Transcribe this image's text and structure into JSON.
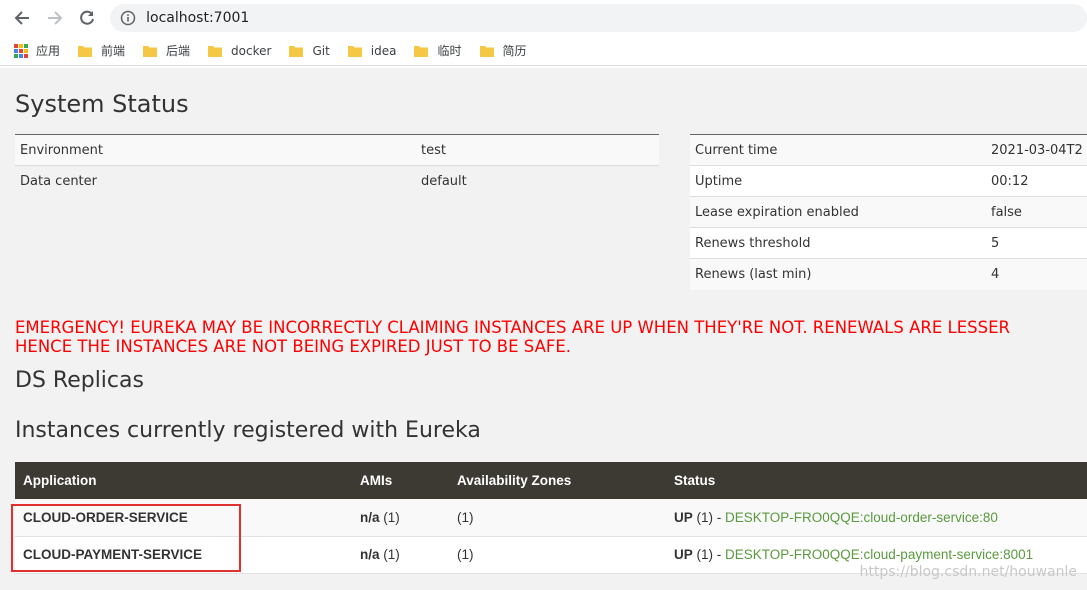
{
  "browser": {
    "url": "localhost:7001",
    "bookmarks": [
      "应用",
      "前端",
      "后端",
      "docker",
      "Git",
      "idea",
      "临时",
      "简历"
    ]
  },
  "page": {
    "title": "System Status",
    "env_rows": [
      {
        "k": "Environment",
        "v": "test"
      },
      {
        "k": "Data center",
        "v": "default"
      }
    ],
    "status_rows": [
      {
        "k": "Current time",
        "v": "2021-03-04T2"
      },
      {
        "k": "Uptime",
        "v": "00:12"
      },
      {
        "k": "Lease expiration enabled",
        "v": "false"
      },
      {
        "k": "Renews threshold",
        "v": "5"
      },
      {
        "k": "Renews (last min)",
        "v": "4"
      }
    ],
    "emergency_line1": "EMERGENCY! EUREKA MAY BE INCORRECTLY CLAIMING INSTANCES ARE UP WHEN THEY'RE NOT. RENEWALS ARE LESSER",
    "emergency_line2": "HENCE THE INSTANCES ARE NOT BEING EXPIRED JUST TO BE SAFE.",
    "replicas_title": "DS Replicas",
    "instances_title": "Instances currently registered with Eureka",
    "columns": [
      "Application",
      "AMIs",
      "Availability Zones",
      "Status"
    ],
    "instances": [
      {
        "app": "CLOUD-ORDER-SERVICE",
        "amis_bold": "n/a",
        "amis_count": " (1)",
        "zones": "(1)",
        "status_bold": "UP",
        "status_count": " (1) - ",
        "link": "DESKTOP-FRO0QQE:cloud-order-service:80"
      },
      {
        "app": "CLOUD-PAYMENT-SERVICE",
        "amis_bold": "n/a",
        "amis_count": " (1)",
        "zones": "(1)",
        "status_bold": "UP",
        "status_count": " (1) - ",
        "link": "DESKTOP-FRO0QQE:cloud-payment-service:8001"
      }
    ],
    "watermark": "https://blog.csdn.net/houwanle"
  }
}
